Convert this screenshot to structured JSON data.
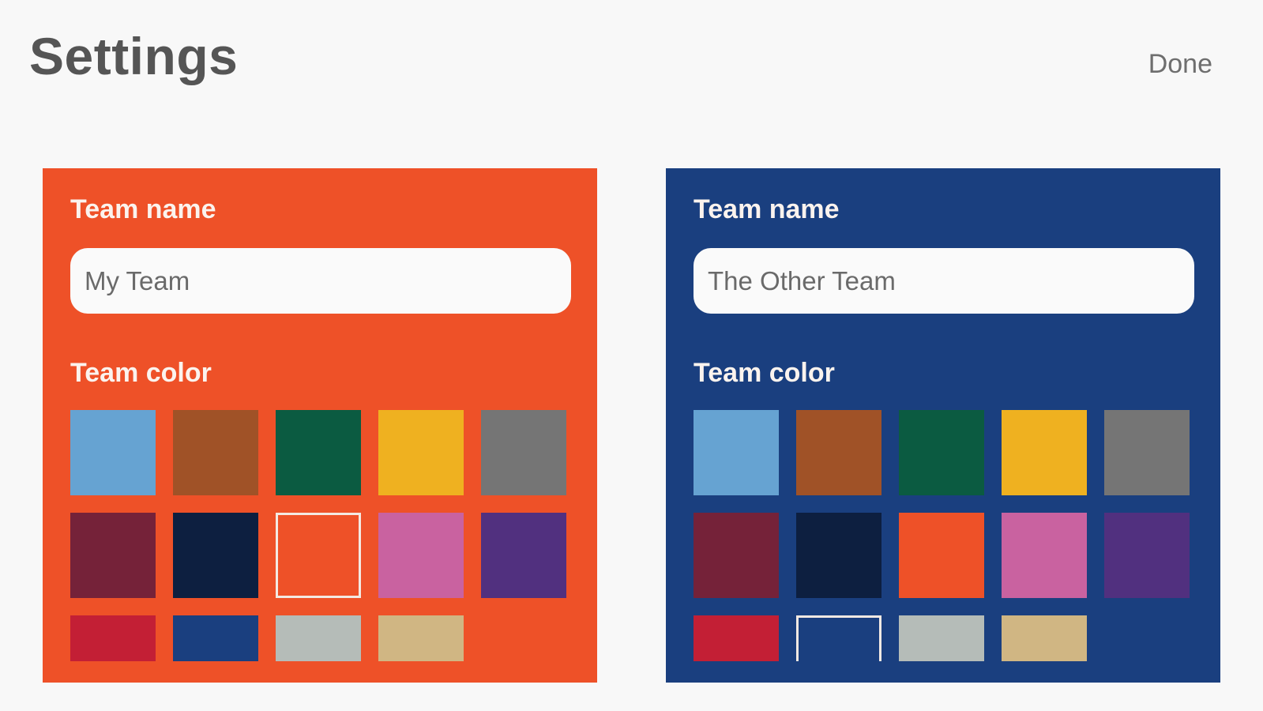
{
  "header": {
    "title": "Settings",
    "done_label": "Done"
  },
  "teams": [
    {
      "card_color": "#ee5128",
      "name_label": "Team name",
      "name_value": "My Team",
      "color_label": "Team color",
      "selected_color": "#ee5128"
    },
    {
      "card_color": "#1a3f7f",
      "name_label": "Team name",
      "name_value": "The Other Team",
      "color_label": "Team color",
      "selected_color": "#1a3f7f"
    }
  ],
  "palette": [
    "#66a3d2",
    "#a05227",
    "#0b5b41",
    "#efb120",
    "#757575",
    "#752239",
    "#0d1f40",
    "#ee5128",
    "#c962a0",
    "#51307f",
    "#c31f35",
    "#1a3f7f",
    "#b5bcb8",
    "#d0b683"
  ]
}
